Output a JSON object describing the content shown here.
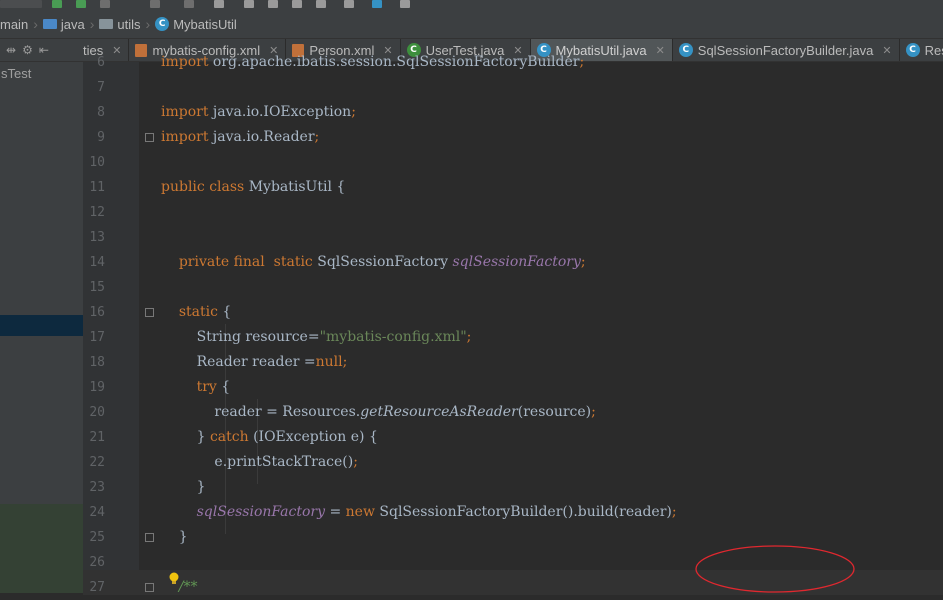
{
  "breadcrumb": [
    {
      "label": "main",
      "icon": "folder-icon"
    },
    {
      "label": "java",
      "icon": "folder-icon"
    },
    {
      "label": "utils",
      "icon": "folder-icon"
    },
    {
      "label": "MybatisUtil",
      "icon": "class-icon"
    }
  ],
  "sidebar": {
    "truncated_tab": "ties",
    "item": "sTest"
  },
  "tabs": [
    {
      "label": "mybatis-config.xml",
      "icon": "xml-file-icon"
    },
    {
      "label": "Person.xml",
      "icon": "xml-file-icon"
    },
    {
      "label": "UserTest.java",
      "icon": "class-icon"
    },
    {
      "label": "MybatisUtil.java",
      "icon": "class-icon",
      "active": true
    },
    {
      "label": "SqlSessionFactoryBuilder.java",
      "icon": "class-icon"
    },
    {
      "label": "Reso",
      "icon": "class-icon"
    }
  ],
  "editor": {
    "lines": [
      {
        "n": "6",
        "text": "import org.apache.ibatis.session.SqlSessionFactoryBuilder;"
      },
      {
        "n": "7",
        "text": ""
      },
      {
        "n": "8",
        "text": "import java.io.IOException;"
      },
      {
        "n": "9",
        "text": "import java.io.Reader;"
      },
      {
        "n": "10",
        "text": ""
      },
      {
        "n": "11",
        "text": "public class MybatisUtil {"
      },
      {
        "n": "12",
        "text": ""
      },
      {
        "n": "13",
        "text": ""
      },
      {
        "n": "14",
        "text": "    private final  static SqlSessionFactory sqlSessionFactory;"
      },
      {
        "n": "15",
        "text": ""
      },
      {
        "n": "16",
        "text": "    static {"
      },
      {
        "n": "17",
        "text": "        String resource=\"mybatis-config.xml\";"
      },
      {
        "n": "18",
        "text": "        Reader reader =null;"
      },
      {
        "n": "19",
        "text": "        try {"
      },
      {
        "n": "20",
        "text": "            reader = Resources.getResourceAsReader(resource);"
      },
      {
        "n": "21",
        "text": "        } catch (IOException e) {"
      },
      {
        "n": "22",
        "text": "            e.printStackTrace();"
      },
      {
        "n": "23",
        "text": "        }"
      },
      {
        "n": "24",
        "text": "        sqlSessionFactory = new SqlSessionFactoryBuilder().build(reader);"
      },
      {
        "n": "25",
        "text": "    }"
      },
      {
        "n": "26",
        "text": ""
      },
      {
        "n": "27",
        "text": "    /**"
      }
    ]
  },
  "colors": {
    "keyword": "#cc7832",
    "string": "#6a8759",
    "field": "#9876aa",
    "annotation_circle": "#e0282f"
  }
}
